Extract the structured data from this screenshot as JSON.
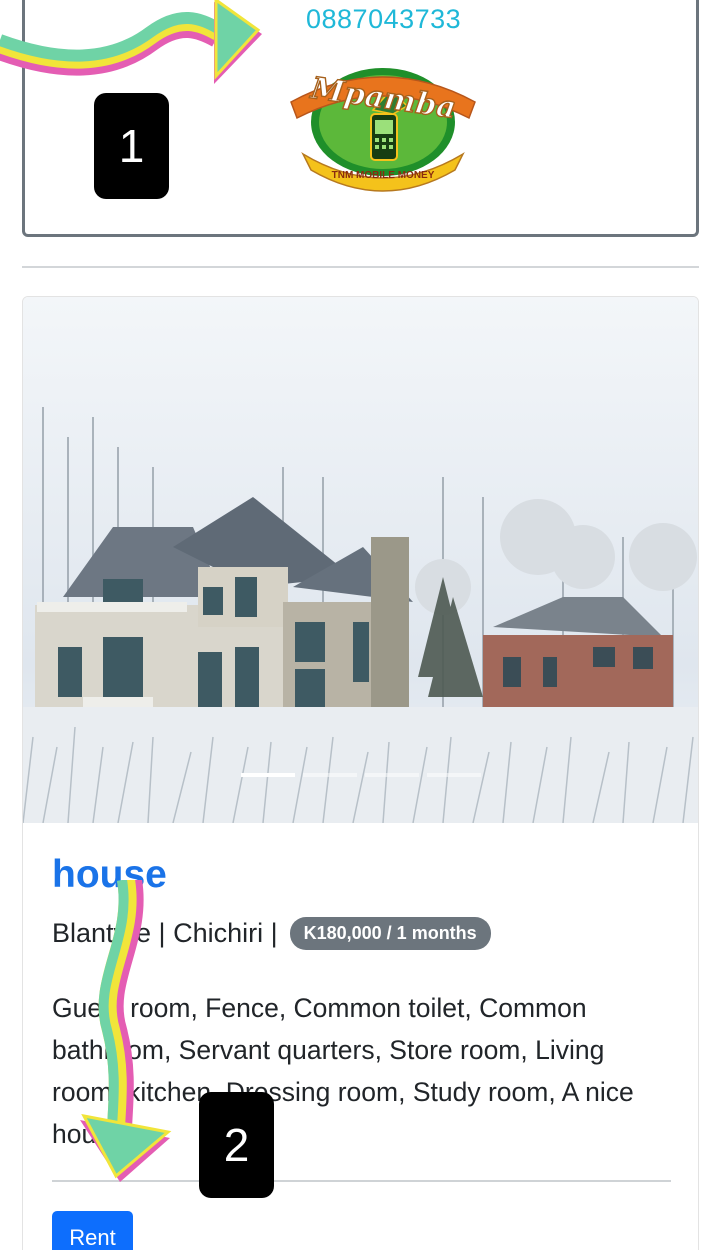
{
  "payment": {
    "phone_number": "0887043733",
    "logo": {
      "name": "Mpamba",
      "tagline": "TNM MOBILE MONEY"
    }
  },
  "markers": {
    "step1": "1",
    "step2": "2"
  },
  "listing": {
    "title": "house",
    "location": "Blantyre | Chichiri |",
    "price": "K180,000 / 1 months",
    "description": "Guest room, Fence, Common toilet, Common bathroom, Servant quarters, Store room, Living room, kitchen, Dressing room, Study room, A nice house",
    "rent_label": "Rent",
    "carousel": {
      "slide_count": 4,
      "active_index": 0
    }
  },
  "colors": {
    "phone_text": "#1fb8d8",
    "title": "#1a73e8",
    "badge": "#6c757d",
    "rent_button": "#0d6efd"
  }
}
